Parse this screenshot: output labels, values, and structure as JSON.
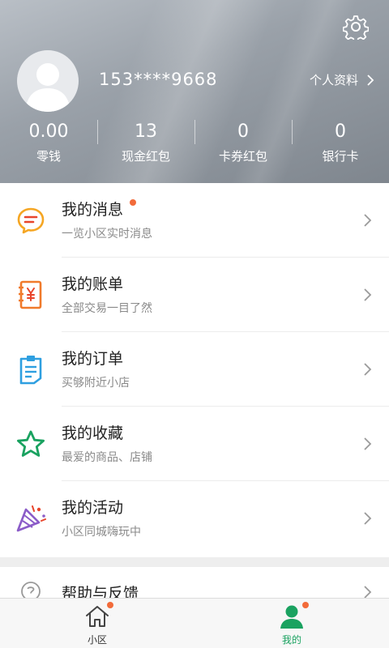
{
  "header": {
    "phone": "153****9668",
    "profile_link": "个人资料",
    "stats": [
      {
        "value": "0.00",
        "label": "零钱"
      },
      {
        "value": "13",
        "label": "现金红包"
      },
      {
        "value": "0",
        "label": "卡券红包"
      },
      {
        "value": "0",
        "label": "银行卡"
      }
    ]
  },
  "menu": {
    "items": [
      {
        "title": "我的消息",
        "subtitle": "一览小区实时消息",
        "icon": "message-icon",
        "has_dot": true
      },
      {
        "title": "我的账单",
        "subtitle": "全部交易一目了然",
        "icon": "bill-icon",
        "has_dot": false
      },
      {
        "title": "我的订单",
        "subtitle": "买够附近小店",
        "icon": "order-icon",
        "has_dot": false
      },
      {
        "title": "我的收藏",
        "subtitle": "最爱的商品、店铺",
        "icon": "star-icon",
        "has_dot": false
      },
      {
        "title": "我的活动",
        "subtitle": "小区同城嗨玩中",
        "icon": "party-icon",
        "has_dot": false
      }
    ],
    "help": {
      "title": "帮助与反馈",
      "icon": "help-icon"
    }
  },
  "tabbar": {
    "tabs": [
      {
        "label": "小区",
        "icon": "home-icon",
        "active": false,
        "has_dot": true
      },
      {
        "label": "我的",
        "icon": "profile-icon",
        "active": true,
        "has_dot": true
      }
    ]
  },
  "colors": {
    "accent_green": "#1aa260",
    "notification_dot": "#f26b3a",
    "message_icon": "#f5a623",
    "bill_icon": "#f07a2b",
    "order_icon": "#2e9fe0",
    "star_icon": "#1aa260",
    "party_icon": "#8b5cc8"
  }
}
